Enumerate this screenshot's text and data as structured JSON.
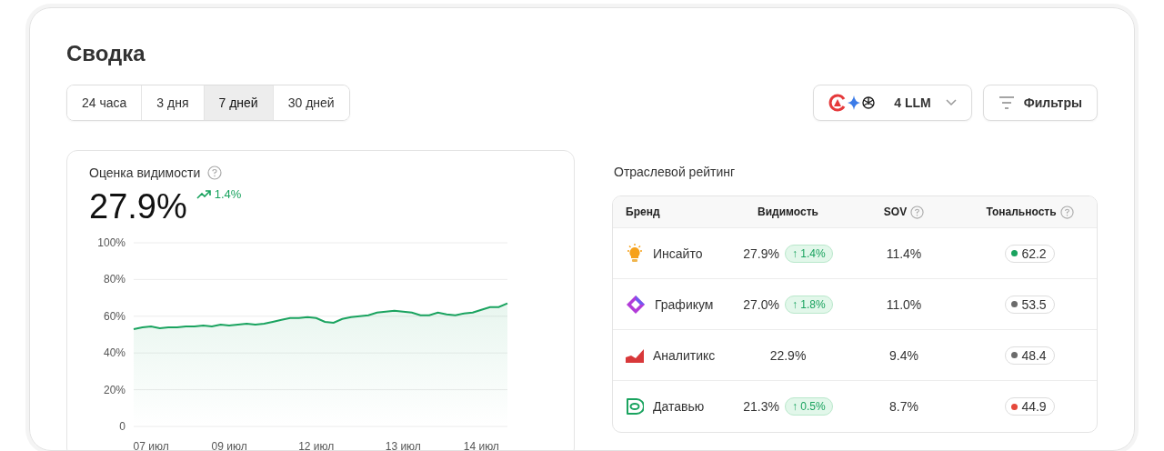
{
  "title": "Сводка",
  "periods": [
    {
      "label": "24 часа",
      "selected": false
    },
    {
      "label": "3 дня",
      "selected": false
    },
    {
      "label": "7 дней",
      "selected": true
    },
    {
      "label": "30 дней",
      "selected": false
    }
  ],
  "llm_button": {
    "label": "4 LLM"
  },
  "filters_button": {
    "label": "Фильтры"
  },
  "visibility_card": {
    "title": "Оценка видимости",
    "value": "27.9%",
    "change": "1.4%",
    "chart_data": {
      "type": "area",
      "categories": [
        null,
        null,
        "07 июл",
        null,
        null,
        null,
        null,
        null,
        null,
        null,
        null,
        "09 июл",
        null,
        null,
        null,
        null,
        null,
        null,
        null,
        null,
        null,
        "12 июл",
        null,
        null,
        null,
        null,
        null,
        null,
        null,
        null,
        null,
        "13 июл",
        null,
        null,
        null,
        null,
        null,
        null,
        null,
        null,
        "14 июл",
        null,
        null,
        null
      ],
      "series": [
        {
          "color": "#1aa35f",
          "values": [
            53,
            54,
            54.5,
            53.5,
            54,
            54,
            54.5,
            54.5,
            55,
            54.5,
            55.5,
            55,
            55.5,
            56,
            55.5,
            56,
            57,
            58,
            59,
            59,
            59.5,
            59,
            57,
            56.5,
            58.5,
            59.5,
            60,
            60.5,
            62,
            62.5,
            63,
            62.5,
            62,
            60.5,
            60.5,
            62,
            61,
            60.5,
            61.5,
            62,
            63.5,
            65,
            65,
            67
          ]
        }
      ],
      "ylim": [
        0,
        100
      ],
      "grid": true,
      "yticks": [
        {
          "value": 0,
          "label": "0"
        },
        {
          "value": 20,
          "label": "20%"
        },
        {
          "value": 40,
          "label": "40%"
        },
        {
          "value": 60,
          "label": "60%"
        },
        {
          "value": 80,
          "label": "80%"
        },
        {
          "value": 100,
          "label": "100%"
        }
      ]
    }
  },
  "ranking": {
    "title": "Отраслевой рейтинг",
    "columns": [
      {
        "label": "Бренд",
        "help": false
      },
      {
        "label": "Видимость",
        "help": false
      },
      {
        "label": "SOV",
        "help": true
      },
      {
        "label": "Тональность",
        "help": true
      }
    ],
    "rows": [
      {
        "kind": "bulb",
        "brand": "Инсайто",
        "visibility": "27.9%",
        "delta": "↑ 1.4%",
        "sov": "11.4%",
        "tone": "62.2",
        "color": "#1aa35f"
      },
      {
        "kind": "diamond",
        "brand": "Графикум",
        "visibility": "27.0%",
        "delta": "↑ 1.8%",
        "sov": "11.0%",
        "tone": "53.5",
        "color": "#6b6b6b"
      },
      {
        "kind": "area",
        "brand": "Аналитикс",
        "visibility": "22.9%",
        "sov": "9.4%",
        "tone": "48.4",
        "color": "#6b6b6b"
      },
      {
        "kind": "eye",
        "brand": "Датавью",
        "visibility": "21.3%",
        "delta": "↑ 0.5%",
        "sov": "8.7%",
        "tone": "44.9",
        "color": "#e5483b"
      }
    ]
  }
}
